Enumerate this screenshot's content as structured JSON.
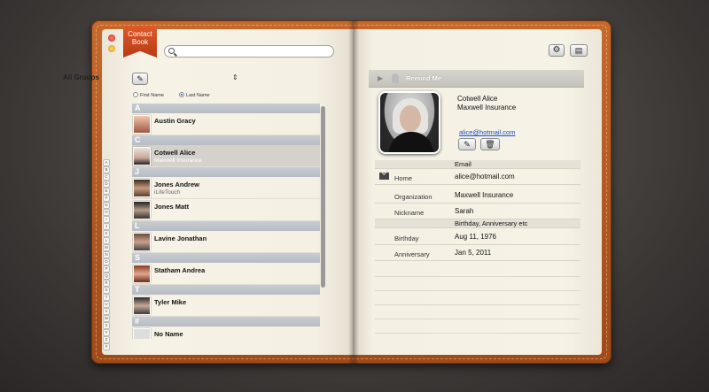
{
  "app": {
    "brand_label": "Contact Book"
  },
  "search": {
    "placeholder": "",
    "value": ""
  },
  "toolbar": {
    "settings_icon": "gear-icon",
    "card_icon": "card-view-icon"
  },
  "groups": {
    "label": "All Groups",
    "edit_icon": "pencil-icon",
    "sort_icon": "up-down-arrows-icon"
  },
  "sort_by": {
    "options": [
      "First Name",
      "Last Name"
    ],
    "selected": "Last Name"
  },
  "contacts": {
    "sections": [
      {
        "letter": "A",
        "items": [
          {
            "name": "Austin Gracy",
            "sub": ""
          }
        ]
      },
      {
        "letter": "C",
        "items": [
          {
            "name": "Cotwell Alice",
            "sub": "Maxwell Insurance",
            "selected": true
          }
        ]
      },
      {
        "letter": "J",
        "items": [
          {
            "name": "Jones Andrew",
            "sub": "iLifeTouch"
          },
          {
            "name": "Jones Matt",
            "sub": ""
          }
        ]
      },
      {
        "letter": "L",
        "items": [
          {
            "name": "Lavine Jonathan",
            "sub": ""
          }
        ]
      },
      {
        "letter": "S",
        "items": [
          {
            "name": "Statham Andrea",
            "sub": ""
          }
        ]
      },
      {
        "letter": "T",
        "items": [
          {
            "name": "Tyler Mike",
            "sub": ""
          }
        ]
      },
      {
        "letter": "#",
        "items": [
          {
            "name": "No Name",
            "sub": ""
          }
        ]
      }
    ]
  },
  "alphabet_index": [
    "A",
    "B",
    "C",
    "D",
    "E",
    "F",
    "G",
    "H",
    "I",
    "J",
    "K",
    "L",
    "M",
    "N",
    "O",
    "P",
    "Q",
    "R",
    "S",
    "T",
    "U",
    "V",
    "W",
    "X",
    "Y",
    "Z",
    "#"
  ],
  "detail": {
    "remind_label": "Remind Me",
    "name": "Cotwell Alice",
    "company": "Maxwell Insurance",
    "email_link": "alice@hotmail.com",
    "email_section": "Email",
    "email_rows": [
      {
        "key": "Home",
        "value": "alice@hotmail.com"
      }
    ],
    "info_rows": [
      {
        "key": "Organization",
        "value": "Maxwell Insurance"
      },
      {
        "key": "Nickname",
        "value": "Sarah"
      }
    ],
    "dates_section": "Birthday, Anniversary etc",
    "date_rows": [
      {
        "key": "Birthday",
        "value": "Aug 11, 1976"
      },
      {
        "key": "Anniversary",
        "value": "Jan 5, 2011"
      }
    ]
  }
}
